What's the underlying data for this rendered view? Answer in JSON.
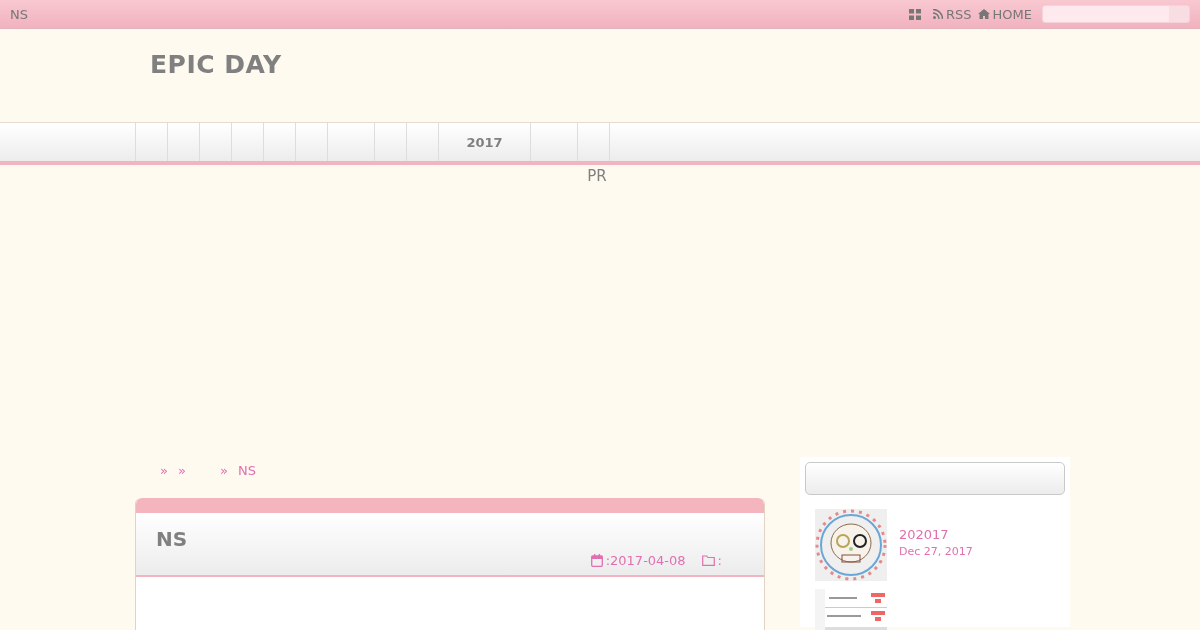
{
  "top_bar": {
    "site_name": "NS",
    "links": [
      {
        "kind": "grid"
      },
      {
        "kind": "rss",
        "label": "RSS"
      },
      {
        "kind": "home",
        "label": "HOME"
      }
    ],
    "search": true
  },
  "header": {
    "title": "EPIC DAY"
  },
  "nav": {
    "items": [
      {
        "kind": "blank"
      },
      {
        "kind": "blank"
      },
      {
        "kind": "blank"
      },
      {
        "kind": "blank"
      },
      {
        "kind": "blank"
      },
      {
        "kind": "blank"
      },
      {
        "kind": "blank",
        "wide": true
      },
      {
        "kind": "blank"
      },
      {
        "kind": "blank"
      },
      {
        "kind": "text",
        "label": "2017"
      },
      {
        "kind": "blank",
        "wide": true
      },
      {
        "kind": "blank"
      }
    ]
  },
  "pr_label": "PR",
  "breadcrumb": [
    "»",
    "»",
    "»",
    "NS"
  ],
  "article": {
    "title": "NS",
    "date": ":2017-04-08",
    "category": ":"
  },
  "sidebar": {
    "posts": [
      {
        "kind": "picture",
        "title": "202017",
        "date": "Dec 27, 2017"
      },
      {
        "kind": "picture"
      }
    ]
  }
}
